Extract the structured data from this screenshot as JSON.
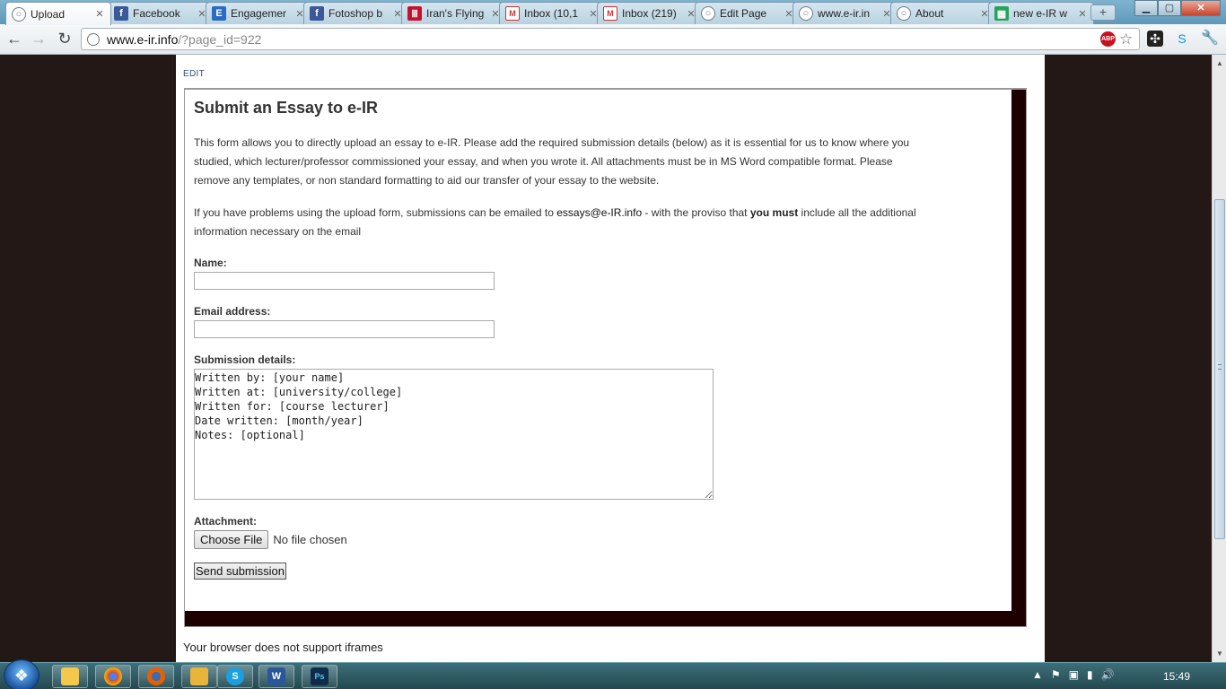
{
  "browser": {
    "tabs": [
      {
        "title": "Upload",
        "favicon": "globe-icon",
        "active": true
      },
      {
        "title": "Facebook",
        "favicon": "facebook-icon",
        "active": false
      },
      {
        "title": "Engagemer",
        "favicon": "engagement-icon",
        "active": false
      },
      {
        "title": "Fotoshop b",
        "favicon": "facebook-icon",
        "active": false
      },
      {
        "title": "Iran's Flying",
        "favicon": "iran-flag-icon",
        "active": false
      },
      {
        "title": "Inbox (10,1",
        "favicon": "gmail-icon",
        "active": false
      },
      {
        "title": "Inbox (219)",
        "favicon": "gmail-icon",
        "active": false
      },
      {
        "title": "Edit Page",
        "favicon": "globe-icon",
        "active": false
      },
      {
        "title": "www.e-ir.in",
        "favicon": "globe-icon",
        "active": false
      },
      {
        "title": "About",
        "favicon": "globe-icon",
        "active": false
      },
      {
        "title": "new e-IR w",
        "favicon": "spreadsheet-icon",
        "active": false
      }
    ],
    "url_host": "www.e-ir.info",
    "url_path": "/?page_id=922",
    "abp_label": "ABP"
  },
  "page": {
    "edit_link": "EDIT",
    "form": {
      "title": "Submit an Essay to e-IR",
      "intro": "This form allows you to directly upload an essay to e-IR. Please add the required submission details (below) as it is essential for us to know where you studied, which lecturer/professor commissioned your essay, and when you wrote it. All attachments must be in MS Word compatible format. Please remove any templates, or non standard formatting to aid our transfer of your essay to the website.",
      "problems_before": "If you have problems using the upload form, submissions can be emailed to ",
      "problems_email": "essays@e-IR.info",
      "problems_middle": " - with the proviso that ",
      "problems_bold": "you must",
      "problems_after": " include all the additional information necessary on the email",
      "name_label": "Name:",
      "name_value": "",
      "email_label": "Email address:",
      "email_value": "",
      "details_label": "Submission details:",
      "details_value": "Written by: [your name]\nWritten at: [university/college]\nWritten for: [course lecturer]\nDate written: [month/year]\nNotes: [optional]",
      "attachment_label": "Attachment:",
      "choose_file_label": "Choose File",
      "file_status": "No file chosen",
      "submit_label": "Send submission"
    },
    "iframe_fallback": "Your browser does not support iframes"
  },
  "taskbar": {
    "clock": "15:49"
  }
}
